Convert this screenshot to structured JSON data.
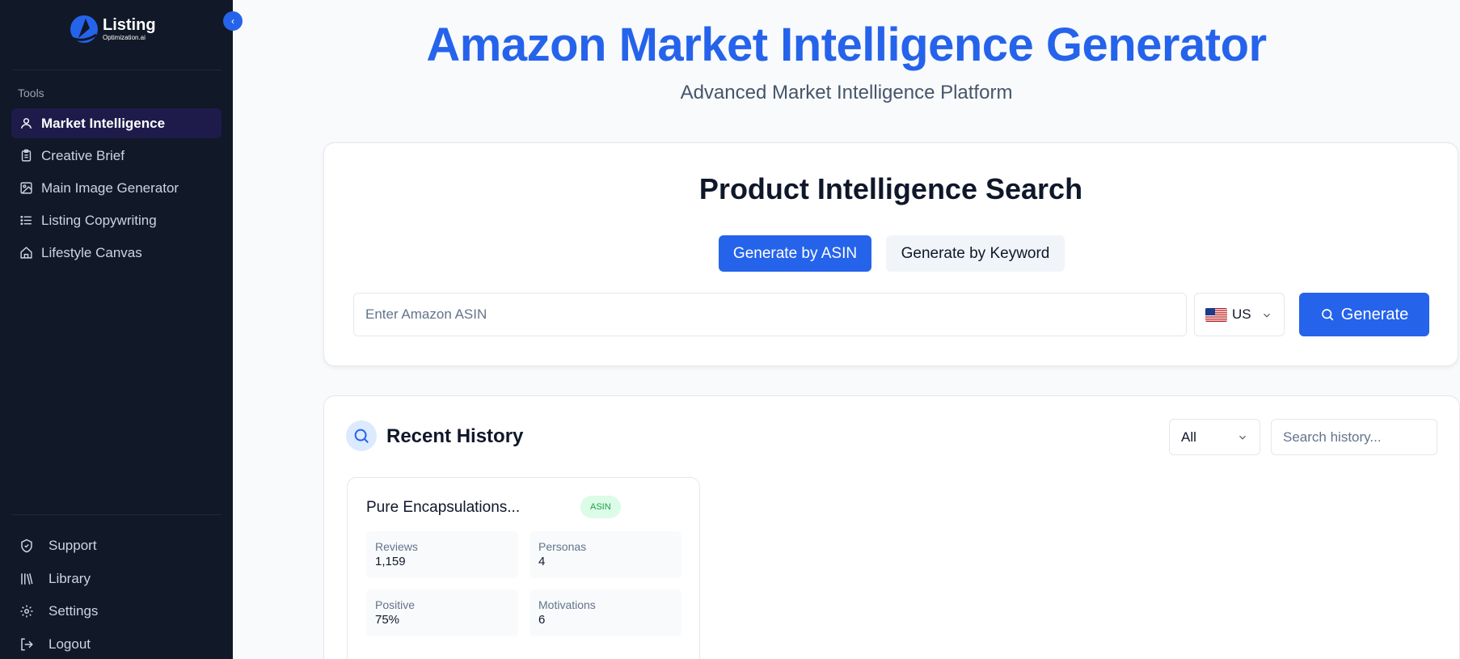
{
  "brand": {
    "title": "Listing",
    "subtitle": "Optimization.ai"
  },
  "sidebar": {
    "collapse_icon": "‹",
    "section_label": "Tools",
    "items": [
      {
        "label": "Market Intelligence",
        "icon": "user-icon",
        "active": true
      },
      {
        "label": "Creative Brief",
        "icon": "clipboard-icon"
      },
      {
        "label": "Main Image Generator",
        "icon": "image-icon"
      },
      {
        "label": "Listing Copywriting",
        "icon": "list-icon"
      },
      {
        "label": "Lifestyle Canvas",
        "icon": "home-icon"
      }
    ],
    "bottom_items": [
      {
        "label": "Support",
        "icon": "shield-icon"
      },
      {
        "label": "Library",
        "icon": "library-icon"
      },
      {
        "label": "Settings",
        "icon": "gear-icon"
      },
      {
        "label": "Logout",
        "icon": "logout-icon"
      }
    ]
  },
  "header": {
    "title": "Amazon Market Intelligence Generator",
    "subtitle": "Advanced Market Intelligence Platform"
  },
  "search": {
    "title": "Product Intelligence Search",
    "mode_asin": "Generate by ASIN",
    "mode_keyword": "Generate by Keyword",
    "input_placeholder": "Enter Amazon ASIN",
    "input_value": "",
    "country": "US",
    "generate_label": "Generate"
  },
  "history": {
    "title": "Recent History",
    "filter_value": "All",
    "search_placeholder": "Search history...",
    "items": [
      {
        "name": "Pure Encapsulations...",
        "badge": "ASIN",
        "stats": [
          {
            "label": "Reviews",
            "value": "1,159"
          },
          {
            "label": "Personas",
            "value": "4"
          },
          {
            "label": "Positive",
            "value": "75%"
          },
          {
            "label": "Motivations",
            "value": "6"
          }
        ]
      }
    ]
  },
  "colors": {
    "sidebar_bg": "#111827",
    "accent": "#2563eb",
    "active_nav": "#1e1b4b",
    "badge_bg": "#dcfce7",
    "badge_text": "#16a34a"
  }
}
